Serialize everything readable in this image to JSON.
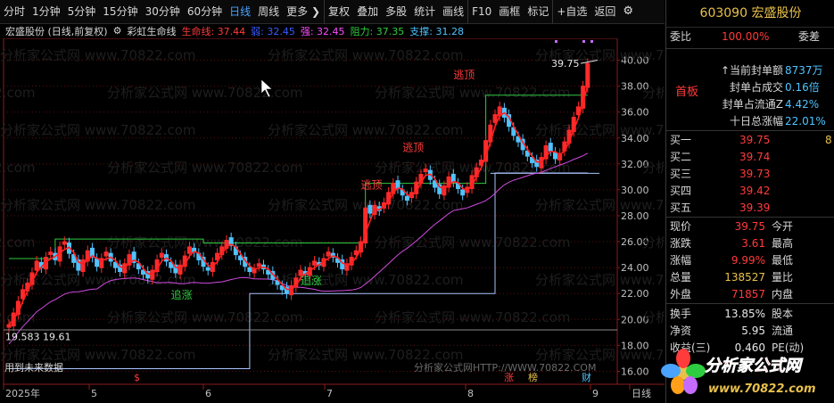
{
  "toolbar": {
    "items": [
      "分时",
      "1分钟",
      "5分钟",
      "15分钟",
      "30分钟",
      "60分钟",
      "日线",
      "周线",
      "更多 ❯",
      "复权",
      "叠加",
      "多股",
      "统计",
      "画线",
      "F10",
      "画框",
      "标记",
      "+自选",
      "返回"
    ],
    "active": "日线",
    "gear_glyph": "⚙"
  },
  "indicator": {
    "stock": "宏盛股份 (日线,前复权)",
    "name": "彩虹生命线",
    "items": [
      {
        "label": "生命线: 37.44",
        "color": "#ff3b3b"
      },
      {
        "label": "弱: 32.45",
        "color": "#3b5bff"
      },
      {
        "label": "强: 32.45",
        "color": "#ff4bff"
      },
      {
        "label": "阻力: 37.35",
        "color": "#2ecc40"
      },
      {
        "label": "支撑: 31.28",
        "color": "#4fc3ff"
      }
    ]
  },
  "chart": {
    "y_ticks": [
      "40.00",
      "38.00",
      "36.00",
      "34.00",
      "32.00",
      "30.00",
      "28.00",
      "26.00",
      "24.00",
      "22.00",
      "20.00",
      "18.00",
      "16.00"
    ],
    "x_labels": [
      "2025年",
      "5",
      "6",
      "7",
      "8",
      "9",
      "日线"
    ],
    "annotations": [
      {
        "text": "逃顶",
        "color": "#ff3b3b"
      },
      {
        "text": "逃顶",
        "color": "#ff3b3b"
      },
      {
        "text": "逃顶",
        "color": "#ff3b3b"
      },
      {
        "text": "追涨",
        "color": "#2ecc40"
      },
      {
        "text": "追涨",
        "color": "#2ecc40"
      }
    ],
    "high_label": "39.75",
    "low_label": "19.583 19.61",
    "future_note": "用到未来数据",
    "watermark_line": "分析家公式网 www.70822.com",
    "bottom_watermark": "分析家公式网HTTP://WWW.70822.COM",
    "event_markers": [
      {
        "text": "$",
        "color": "#ff3b3b"
      },
      {
        "text": "涨",
        "color": "#ff3b3b"
      },
      {
        "text": "榜",
        "color": "#e8c14a"
      },
      {
        "text": "财",
        "color": "#4fc3ff"
      }
    ]
  },
  "chart_data": {
    "type": "candlestick",
    "ylim": [
      15,
      41
    ],
    "x_labels": [
      "2025年",
      "5",
      "6",
      "7",
      "8",
      "9"
    ],
    "close_series": [
      19.6,
      20.5,
      21.4,
      22.3,
      22.8,
      23.6,
      24.5,
      24.0,
      24.8,
      25.2,
      24.6,
      25.6,
      26.0,
      25.1,
      24.4,
      23.8,
      24.6,
      25.3,
      24.8,
      24.1,
      24.7,
      25.2,
      24.5,
      24.0,
      23.7,
      24.3,
      25.0,
      24.4,
      23.9,
      23.5,
      23.2,
      23.8,
      24.6,
      25.1,
      24.5,
      24.0,
      23.6,
      24.2,
      24.9,
      25.6,
      25.2,
      24.6,
      24.1,
      23.8,
      24.4,
      25.1,
      25.6,
      26.1,
      25.7,
      25.0,
      24.6,
      24.1,
      23.7,
      23.9,
      24.3,
      23.9,
      23.5,
      23.1,
      22.7,
      22.3,
      22.0,
      22.6,
      23.2,
      23.8,
      23.5,
      24.0,
      24.5,
      24.2,
      24.7,
      25.2,
      24.8,
      24.4,
      23.9,
      24.3,
      24.8,
      25.3,
      26.0,
      28.6,
      28.2,
      28.8,
      28.4,
      29.0,
      29.8,
      30.5,
      30.1,
      29.6,
      29.2,
      29.8,
      30.6,
      31.2,
      31.6,
      30.8,
      30.2,
      29.7,
      30.3,
      31.0,
      30.6,
      30.1,
      29.6,
      30.2,
      31.1,
      31.7,
      32.3,
      33.8,
      35.0,
      35.8,
      36.4,
      35.6,
      34.9,
      34.2,
      33.7,
      33.1,
      32.6,
      32.1,
      31.8,
      32.5,
      33.4,
      33.0,
      32.4,
      32.8,
      33.7,
      34.6,
      35.6,
      36.4,
      38.0,
      39.75
    ],
    "life_line": [
      37.44
    ],
    "weak": [
      32.45
    ],
    "strong": [
      32.45
    ],
    "resistance": [
      37.35
    ],
    "support": [
      31.28
    ]
  },
  "right": {
    "title": "603090 宏盛股份",
    "weibi_label": "委比",
    "weibi_val": "100.00%",
    "weicha_label": "委差",
    "seal_rows": [
      {
        "label": "↑当前封单额",
        "val": "8737万"
      },
      {
        "label": "封单占成交",
        "val": "0.16倍"
      },
      {
        "label": "封单占流通Z",
        "val": "4.42%"
      },
      {
        "label": "十日总涨幅",
        "val": "22.01%"
      }
    ],
    "board_label": "首板",
    "bids": [
      {
        "label": "买一",
        "price": "39.75",
        "vol": "8"
      },
      {
        "label": "买二",
        "price": "39.74",
        "vol": ""
      },
      {
        "label": "买三",
        "price": "39.73",
        "vol": ""
      },
      {
        "label": "买四",
        "price": "39.42",
        "vol": ""
      },
      {
        "label": "买五",
        "price": "39.39",
        "vol": ""
      }
    ],
    "quote": [
      {
        "l1": "现价",
        "v1": "39.75",
        "c1": "red",
        "l2": "今开",
        "v2": ""
      },
      {
        "l1": "涨跌",
        "v1": "3.61",
        "c1": "red",
        "l2": "最高",
        "v2": ""
      },
      {
        "l1": "涨幅",
        "v1": "9.99%",
        "c1": "red",
        "l2": "最低",
        "v2": ""
      },
      {
        "l1": "总量",
        "v1": "138527",
        "c1": "yel",
        "l2": "量比",
        "v2": ""
      },
      {
        "l1": "外盘",
        "v1": "71857",
        "c1": "red",
        "l2": "内盘",
        "v2": ""
      }
    ],
    "stats": [
      {
        "l1": "换手",
        "v1": "13.85%",
        "l2": "股本"
      },
      {
        "l1": "净资",
        "v1": "5.95",
        "l2": "流通"
      },
      {
        "l1": "收益(三)",
        "v1": "0.460",
        "l2": "PE(动)"
      }
    ]
  },
  "logo": {
    "title": "分析家公式网",
    "url": "www.70822.com"
  }
}
